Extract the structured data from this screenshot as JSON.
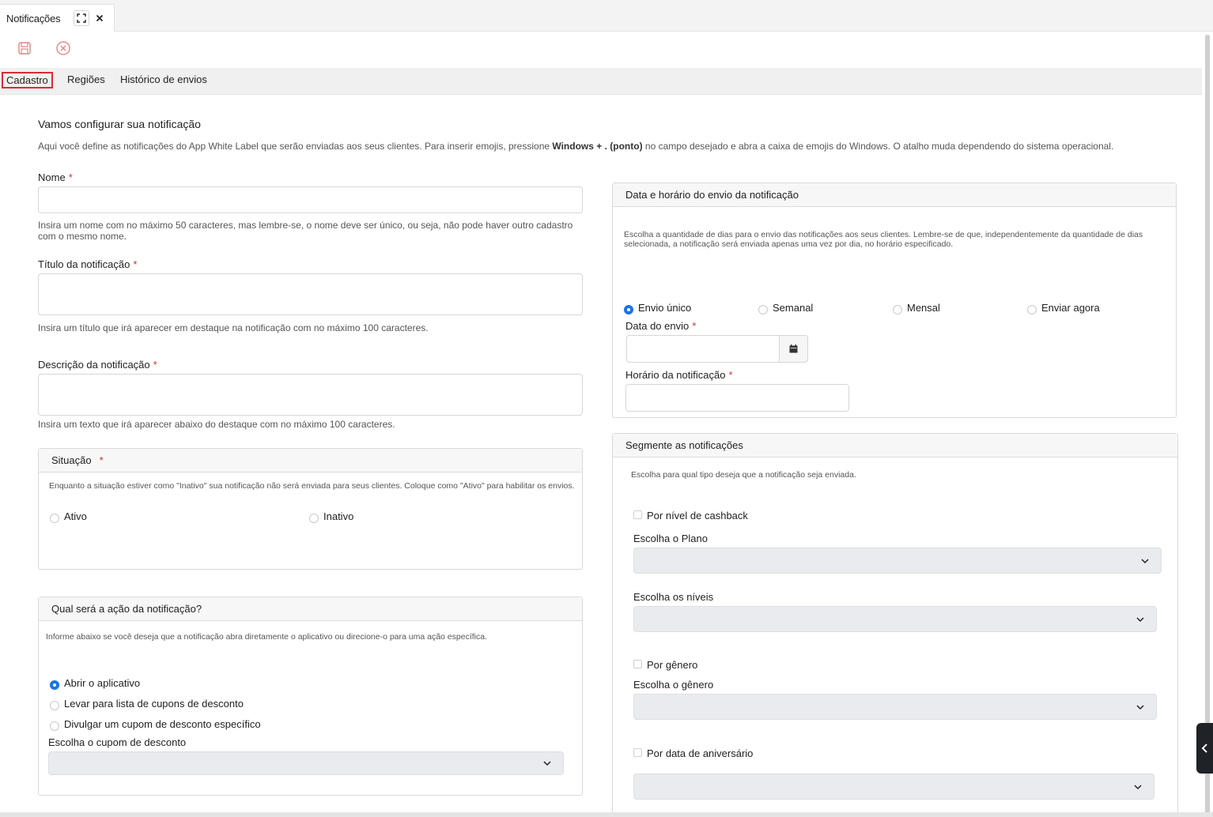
{
  "window": {
    "tab_title": "Notificações"
  },
  "toolbar": {
    "save_icon": "save-icon",
    "cancel_icon": "cancel-icon"
  },
  "subtabs": [
    {
      "label": "Cadastro",
      "active": true
    },
    {
      "label": "Regiões"
    },
    {
      "label": "Histórico de envios"
    }
  ],
  "form": {
    "heading": "Vamos configurar sua notificação",
    "intro_part1": "Aqui você define as notificações do App White Label que serão enviadas aos seus clientes. Para inserir emojis, pressione ",
    "intro_bold": "Windows + . (ponto)",
    "intro_part2": " no campo desejado e abra a caixa de emojis do Windows. O atalho muda dependendo do sistema operacional.",
    "nome": {
      "label": "Nome",
      "required": "*",
      "value": "",
      "help": "Insira um nome com no máximo 50 caracteres, mas lembre-se, o nome deve ser único, ou seja, não pode haver outro cadastro com o mesmo nome."
    },
    "titulo": {
      "label": "Título da notificação",
      "required": "*",
      "value": "",
      "help": "Insira um título que irá aparecer em destaque na notificação com no máximo 100 caracteres."
    },
    "descricao": {
      "label": "Descrição da notificação",
      "required": "*",
      "value": "",
      "help": "Insira um texto que irá aparecer abaixo do destaque com no máximo 100 caracteres."
    },
    "situacao": {
      "title": "Situação",
      "required": "*",
      "help": "Enquanto a situação estiver como \"Inativo\" sua notificação não será enviada para seus clientes. Coloque como \"Ativo\" para habilitar os envios.",
      "options": [
        "Ativo",
        "Inativo"
      ]
    },
    "acao": {
      "title": "Qual será a ação da notificação?",
      "help": "Informe abaixo se você deseja que a notificação abra diretamente o aplicativo ou direcione-o para uma ação específica.",
      "options": [
        "Abrir o aplicativo",
        "Levar para lista de cupons de desconto",
        "Divulgar um cupom de desconto específico"
      ],
      "selected": "Abrir o aplicativo",
      "cupom_label": "Escolha o cupom de desconto",
      "cupom_value": ""
    },
    "envio": {
      "title": "Data e horário do envio da notificação",
      "help": "Escolha a quantidade de dias para o envio das notificações aos seus clientes. Lembre-se de que, independentemente da quantidade de dias selecionada, a notificação será enviada apenas uma vez por dia, no horário especificado.",
      "options": [
        "Envio único",
        "Semanal",
        "Mensal",
        "Enviar agora"
      ],
      "selected": "Envio único",
      "data_label": "Data do envio",
      "data_required": "*",
      "data_value": "",
      "hora_label": "Horário da notificação",
      "hora_required": "*",
      "hora_value": ""
    },
    "segmento": {
      "title": "Segmente as notificações",
      "help": "Escolha para qual tipo deseja que a notificação seja enviada.",
      "cashback_label": "Por nível de cashback",
      "plano_label": "Escolha o Plano",
      "niveis_label": "Escolha os níveis",
      "genero_check": "Por gênero",
      "genero_label": "Escolha o gênero",
      "aniversario_check": "Por data de aniversário"
    }
  },
  "colors": {
    "accent": "#1a73e8",
    "required": "#d32f2f",
    "active_tab_border": "#d32f2f",
    "icon_red": "#e57373"
  }
}
